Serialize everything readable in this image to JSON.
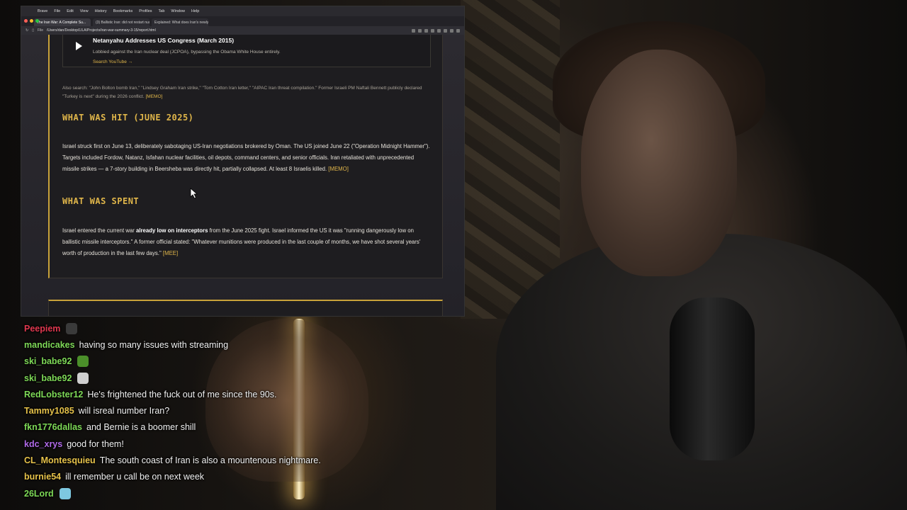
{
  "browser": {
    "menu": [
      "Brave",
      "File",
      "Edit",
      "View",
      "History",
      "Bookmarks",
      "Profiles",
      "Tab",
      "Window",
      "Help"
    ],
    "tabs": [
      {
        "label": "The Iran War: A Complete Su..."
      },
      {
        "label": "(3) Ballistic Iran: did not restart nucl..."
      },
      {
        "label": "Explained: What does Iran's newly..."
      }
    ],
    "address": {
      "prefix": "File",
      "url": "/Users/dan/Desktop/LILA/Projects/iran-war-summary-3-15/report.html"
    }
  },
  "page": {
    "video": {
      "title": "Netanyahu Addresses US Congress (March 2015)",
      "description": "Lobbied against the Iran nuclear deal (JCPOA), bypassing the Obama White House entirely.",
      "link": "Search YouTube →"
    },
    "also_search": {
      "text": "Also search: \"John Bolton bomb Iran,\" \"Lindsey Graham Iran strike,\" \"Tom Cotton Iran letter,\" \"AIPAC Iran threat compilation.\" Former Israeli PM Naftali Bennett publicly declared \"Turkey is next\" during the 2026 conflict.",
      "memo": "[MEMO]"
    },
    "hit": {
      "heading": "WHAT WAS HIT (JUNE 2025)",
      "text": "Israel struck first on June 13, deliberately sabotaging US-Iran negotiations brokered by Oman. The US joined June 22 (\"Operation Midnight Hammer\"). Targets included Fordow, Natanz, Isfahan nuclear facilities, oil depots, command centers, and senior officials. Iran retaliated with unprecedented missile strikes — a 7-story building in Beersheba was directly hit, partially collapsed. At least 8 Israelis killed.",
      "memo": "[MEMO]"
    },
    "spent": {
      "heading": "WHAT WAS SPENT",
      "text_before": "Israel entered the current war ",
      "text_bold": "already low on interceptors",
      "text_after": " from the June 2025 fight. Israel informed the US it was \"running dangerously low on ballistic missile interceptors.\" A former official stated: \"Whatever munitions were produced in the last couple of months, we have shot several years' worth of production in the last few days.\"",
      "memo": "[MEE]"
    }
  },
  "chat": [
    {
      "user": "Peepiem",
      "color": "#e0384f",
      "message": "",
      "emote": "#3a3a3a"
    },
    {
      "user": "mandicakes",
      "color": "#7ed957",
      "message": "having so many issues with streaming",
      "emote": ""
    },
    {
      "user": "ski_babe92",
      "color": "#7ed957",
      "message": "",
      "emote": "#4b8f2a"
    },
    {
      "user": "ski_babe92",
      "color": "#7ed957",
      "message": "",
      "emote": "#cfcfcf"
    },
    {
      "user": "RedLobster12",
      "color": "#7ed957",
      "message": "He's frightened the fuck out of me since the 90s.",
      "emote": ""
    },
    {
      "user": "Tammy1085",
      "color": "#e6c24a",
      "message": "will isreal number Iran?",
      "emote": ""
    },
    {
      "user": "fkn1776dallas",
      "color": "#7ed957",
      "message": "and Bernie is a boomer shill",
      "emote": ""
    },
    {
      "user": "kdc_xrys",
      "color": "#b06ae8",
      "message": "good for them!",
      "emote": ""
    },
    {
      "user": "CL_Montesquieu",
      "color": "#e6c24a",
      "message": "The south coast of Iran is also a mountenous nightmare.",
      "emote": ""
    },
    {
      "user": "burnie54",
      "color": "#e6c24a",
      "message": "ill remember u call be on next week",
      "emote": ""
    },
    {
      "user": "26Lord",
      "color": "#7ed957",
      "message": "",
      "emote": "#7ec8e0"
    }
  ]
}
